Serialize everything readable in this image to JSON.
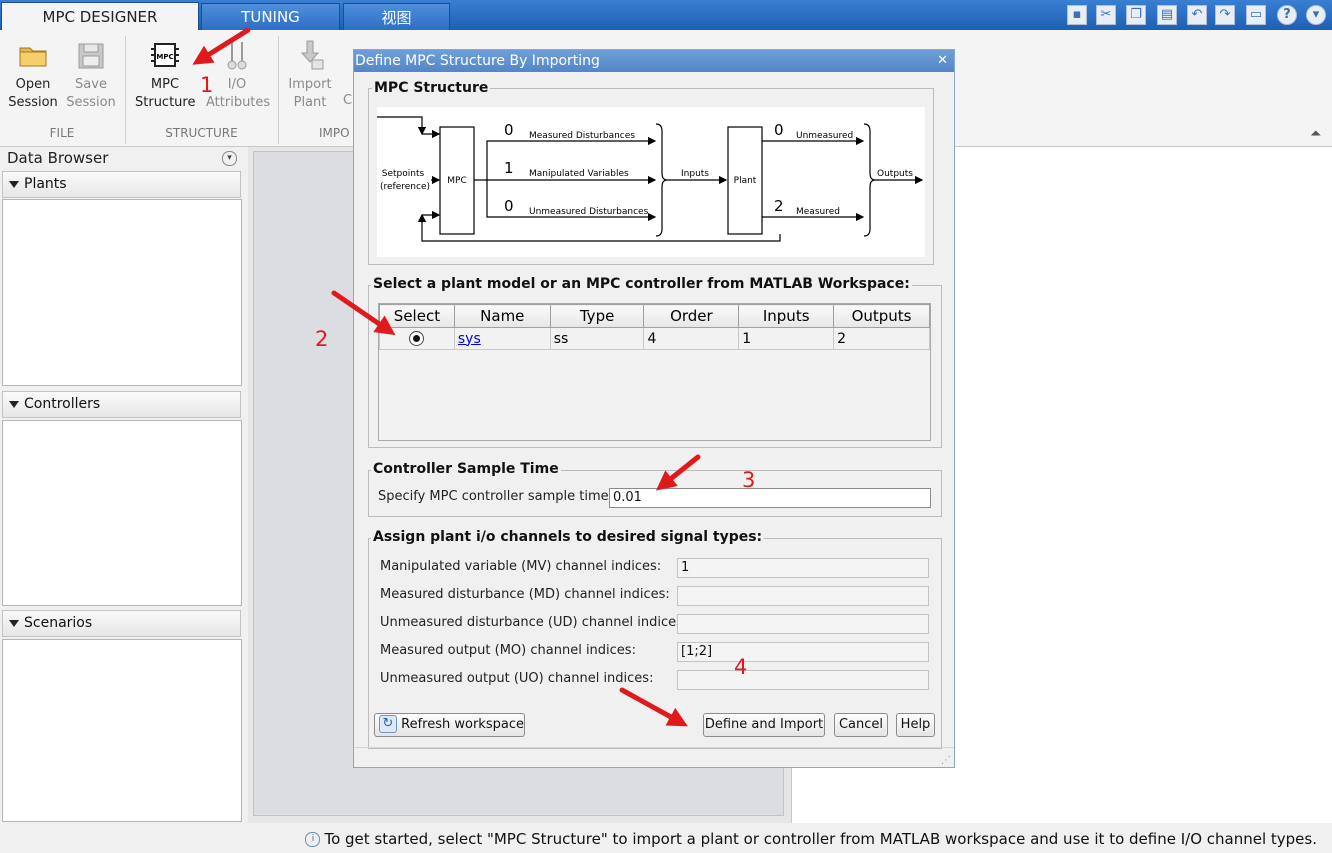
{
  "tabs": [
    {
      "label": "MPC DESIGNER",
      "active": true
    },
    {
      "label": "TUNING",
      "active": false
    },
    {
      "label": "视图",
      "active": false
    }
  ],
  "ribbon": {
    "open_session": [
      "Open",
      "Session"
    ],
    "save_session": [
      "Save",
      "Session"
    ],
    "mpc_structure": [
      "MPC",
      "Structure"
    ],
    "io_attributes": [
      "I/O",
      "Attributes"
    ],
    "import_plant": [
      "Import",
      "Plant"
    ],
    "import_c_partial": "C",
    "groups": {
      "file": "FILE",
      "structure": "STRUCTURE",
      "import": "IMPO"
    }
  },
  "data_browser": {
    "title": "Data Browser",
    "sections": [
      "Plants",
      "Controllers",
      "Scenarios"
    ]
  },
  "dialog": {
    "title": "Define MPC Structure By Importing",
    "close_glyph": "✕",
    "structure_legend": "MPC Structure",
    "diagram": {
      "setpoints": "Setpoints",
      "reference": "(reference)",
      "mpc": "MPC",
      "plant": "Plant",
      "inputs": "Inputs",
      "outputs": "Outputs",
      "md_count": "0",
      "md_label": "Measured Disturbances",
      "mv_count": "1",
      "mv_label": "Manipulated Variables",
      "ud_count": "0",
      "ud_label": "Unmeasured Disturbances",
      "uo_count": "0",
      "uo_label": "Unmeasured",
      "mo_count": "2",
      "mo_label": "Measured"
    },
    "select_legend": "Select a plant model or an MPC controller from MATLAB Workspace:",
    "table": {
      "headers": [
        "Select",
        "Name",
        "Type",
        "Order",
        "Inputs",
        "Outputs"
      ],
      "rows": [
        {
          "name": "sys",
          "type": "ss",
          "order": "4",
          "inputs": "1",
          "outputs": "2",
          "selected": true
        }
      ]
    },
    "sample_legend": "Controller Sample Time",
    "sample_label": "Specify MPC controller sample time:",
    "sample_value": "0.01",
    "assign_legend": "Assign plant i/o channels to desired signal types:",
    "channels": [
      {
        "label": "Manipulated variable (MV) channel indices:",
        "value": "1"
      },
      {
        "label": "Measured disturbance (MD) channel indices:",
        "value": ""
      },
      {
        "label": "Unmeasured disturbance (UD) channel indices:",
        "value": ""
      },
      {
        "label": "Measured output (MO) channel indices:",
        "value": "[1;2]"
      },
      {
        "label": "Unmeasured output (UO) channel indices:",
        "value": ""
      }
    ],
    "buttons": {
      "refresh": "Refresh workspace",
      "define": "Define and Import",
      "cancel": "Cancel",
      "help": "Help"
    }
  },
  "annotations": [
    "1",
    "2",
    "3",
    "4"
  ],
  "colors": {
    "accent": "#2d6ec4",
    "annotation": "#e0191d",
    "link": "#0000ee"
  },
  "status_text": "To get started, select \"MPC Structure\" to import a plant or controller from MATLAB workspace and use it to define I/O channel types."
}
